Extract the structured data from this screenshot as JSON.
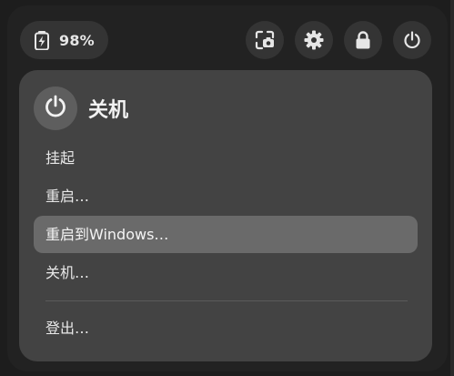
{
  "status": {
    "battery_percent": "98%",
    "battery_icon": "battery-charging-icon"
  },
  "quick_buttons": [
    {
      "name": "screenshot-button",
      "icon": "screenshot-icon"
    },
    {
      "name": "settings-button",
      "icon": "gear-icon"
    },
    {
      "name": "lock-button",
      "icon": "lock-icon"
    },
    {
      "name": "power-button",
      "icon": "power-icon"
    }
  ],
  "power_menu": {
    "title": "关机",
    "icon": "power-icon",
    "items": [
      {
        "label": "挂起"
      },
      {
        "label": "重启…"
      },
      {
        "label": "重启到Windows…",
        "highlighted": true
      },
      {
        "label": "关机…"
      }
    ],
    "logout": {
      "label": "登出…"
    }
  },
  "colors": {
    "panel_bg": "#222222",
    "button_bg": "#343434",
    "card_bg": "#434343",
    "highlight_bg": "#6a6a6a",
    "text": "#e8e8e8"
  }
}
